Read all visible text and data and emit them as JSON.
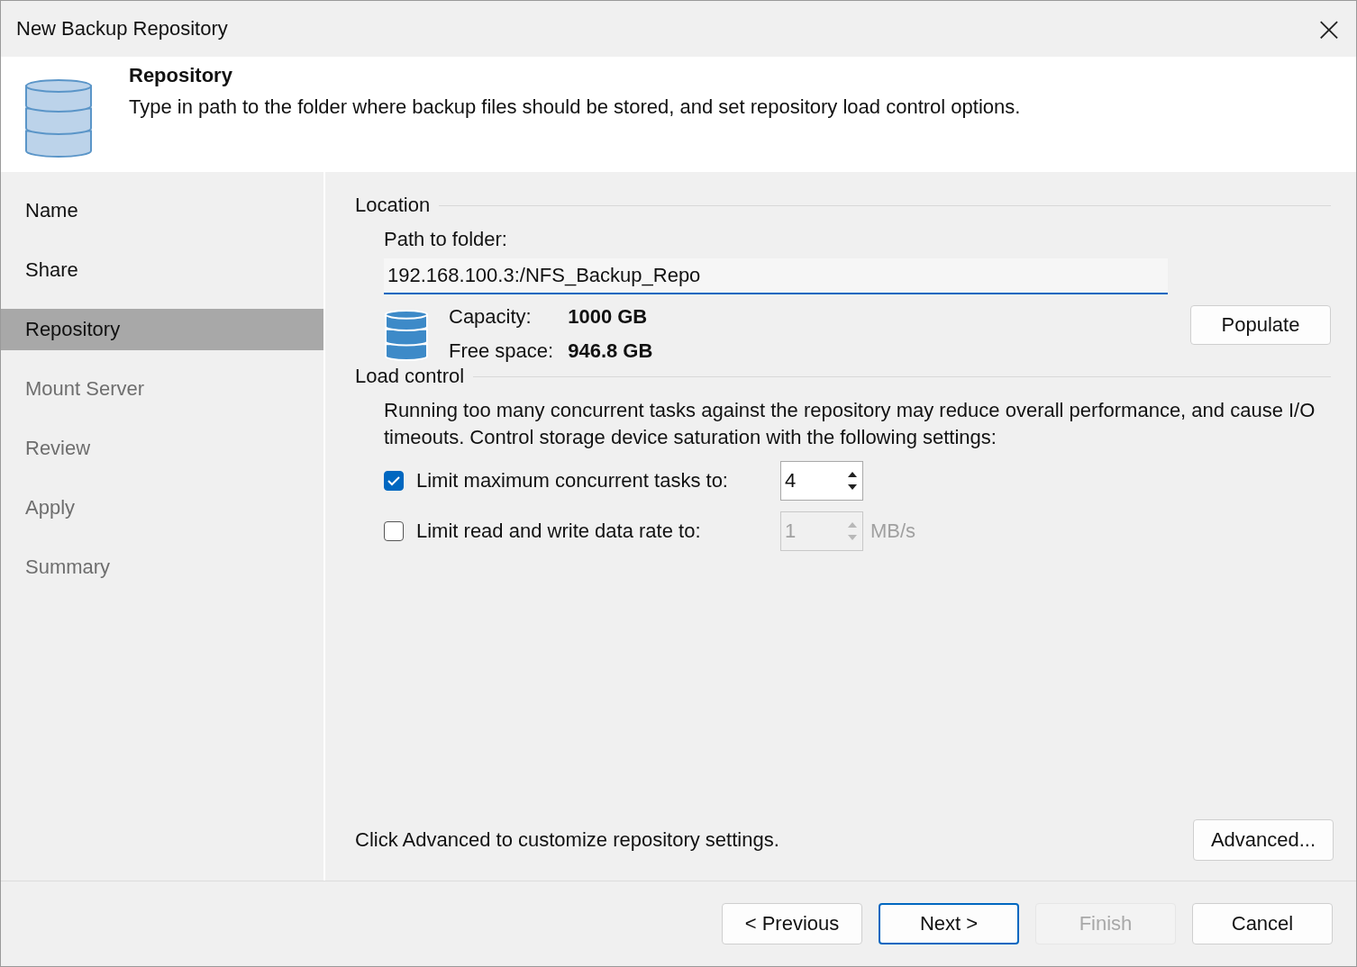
{
  "window": {
    "title": "New Backup Repository",
    "close": "×"
  },
  "header": {
    "title": "Repository",
    "description": "Type in path to the folder where backup files should be stored, and set repository load control options."
  },
  "steps": [
    {
      "label": "Name",
      "selected": false,
      "disabled": false
    },
    {
      "label": "Share",
      "selected": false,
      "disabled": false
    },
    {
      "label": "Repository",
      "selected": true,
      "disabled": false
    },
    {
      "label": "Mount Server",
      "selected": false,
      "disabled": true
    },
    {
      "label": "Review",
      "selected": false,
      "disabled": true
    },
    {
      "label": "Apply",
      "selected": false,
      "disabled": true
    },
    {
      "label": "Summary",
      "selected": false,
      "disabled": true
    }
  ],
  "location": {
    "heading": "Location",
    "path_label": "Path to folder:",
    "path_value": "192.168.100.3:/NFS_Backup_Repo",
    "capacity_label": "Capacity:",
    "capacity_value": "1000 GB",
    "free_label": "Free space:",
    "free_value": "946.8 GB",
    "populate_button": "Populate"
  },
  "load_control": {
    "heading": "Load control",
    "description": "Running too many concurrent tasks against the repository may reduce overall performance, and cause I/O timeouts. Control storage device saturation with the following settings:",
    "options": [
      {
        "label": "Limit maximum concurrent tasks to:",
        "checked": true,
        "value": "4",
        "disabled": false
      },
      {
        "label": "Limit read and write data rate to:",
        "checked": false,
        "value": "1",
        "unit": "MB/s",
        "disabled": true
      }
    ]
  },
  "advanced": {
    "hint": "Click Advanced to customize repository settings.",
    "button": "Advanced..."
  },
  "buttons": [
    {
      "label": "< Previous",
      "kind": "normal"
    },
    {
      "label": "Next >",
      "kind": "default"
    },
    {
      "label": "Finish",
      "kind": "disabled"
    },
    {
      "label": "Cancel",
      "kind": "normal"
    }
  ]
}
